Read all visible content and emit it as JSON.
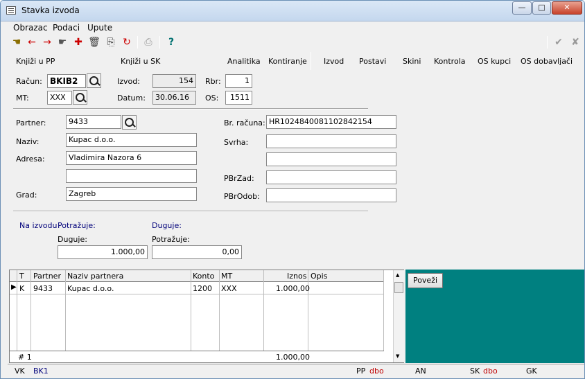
{
  "window": {
    "title": "Stavka izvoda"
  },
  "menu": [
    "Obrazac",
    "Podaci",
    "Upute"
  ],
  "topbar": {
    "links": [
      "Knjiži u PP",
      "Knjiži u SK",
      "Analitika",
      "Kontiranje",
      "Izvod",
      "Postavi",
      "Skini",
      "Kontrola",
      "OS kupci",
      "OS dobavljači"
    ]
  },
  "header": {
    "racun_label": "Račun:",
    "racun_value": "BKIB2",
    "mt_label": "MT:",
    "mt_value": "XXX",
    "izvod_label": "Izvod:",
    "izvod_value": "154",
    "datum_label": "Datum:",
    "datum_value": "30.06.16",
    "rbr_label": "Rbr:",
    "rbr_value": "1",
    "os_label": "OS:",
    "os_value": "1511"
  },
  "partner": {
    "partner_label": "Partner:",
    "partner_value": "9433",
    "naziv_label": "Naziv:",
    "naziv_value": "Kupac d.o.o.",
    "adresa_label": "Adresa:",
    "adresa_value": "Vladimira Nazora 6",
    "adresa2_value": "",
    "grad_label": "Grad:",
    "grad_value": "Zagreb",
    "brracuna_label": "Br. računa:",
    "brracuna_value": "HR1024840081102842154",
    "svrha_label": "Svrha:",
    "svrha_value": "",
    "svrha2_value": "",
    "pbrzad_label": "PBrZad:",
    "pbrzad_value": "",
    "pbrodob_label": "PBrOdob:",
    "pbrodob_value": ""
  },
  "amounts": {
    "na_izvodu": "Na izvodu",
    "potrazuje_top": "Potražuje:",
    "duguje_top": "Duguje:",
    "duguje_label": "Duguje:",
    "duguje_value": "1.000,00",
    "potrazuje_label": "Potražuje:",
    "potrazuje_value": "0,00"
  },
  "grid": {
    "headers": [
      "T",
      "Partner",
      "Naziv partnera",
      "Konto",
      "MT",
      "Iznos",
      "Opis"
    ],
    "rows": [
      {
        "t": "K",
        "partner": "9433",
        "naziv": "Kupac d.o.o.",
        "konto": "1200",
        "mt": "XXX",
        "iznos": "1.000,00",
        "opis": ""
      }
    ],
    "footer_count": "# 1",
    "footer_total": "1.000,00"
  },
  "poveži_label": "Poveži",
  "status": {
    "vk_label": "VK",
    "vk_value": "BK1",
    "pp_label": "PP",
    "pp_value": "dbo",
    "an_label": "AN",
    "sk_label": "SK",
    "sk_value": "dbo",
    "gk_label": "GK"
  },
  "colors": {
    "teal": "#008080",
    "status_red": "#c00000",
    "label_blue": "#00007a"
  }
}
